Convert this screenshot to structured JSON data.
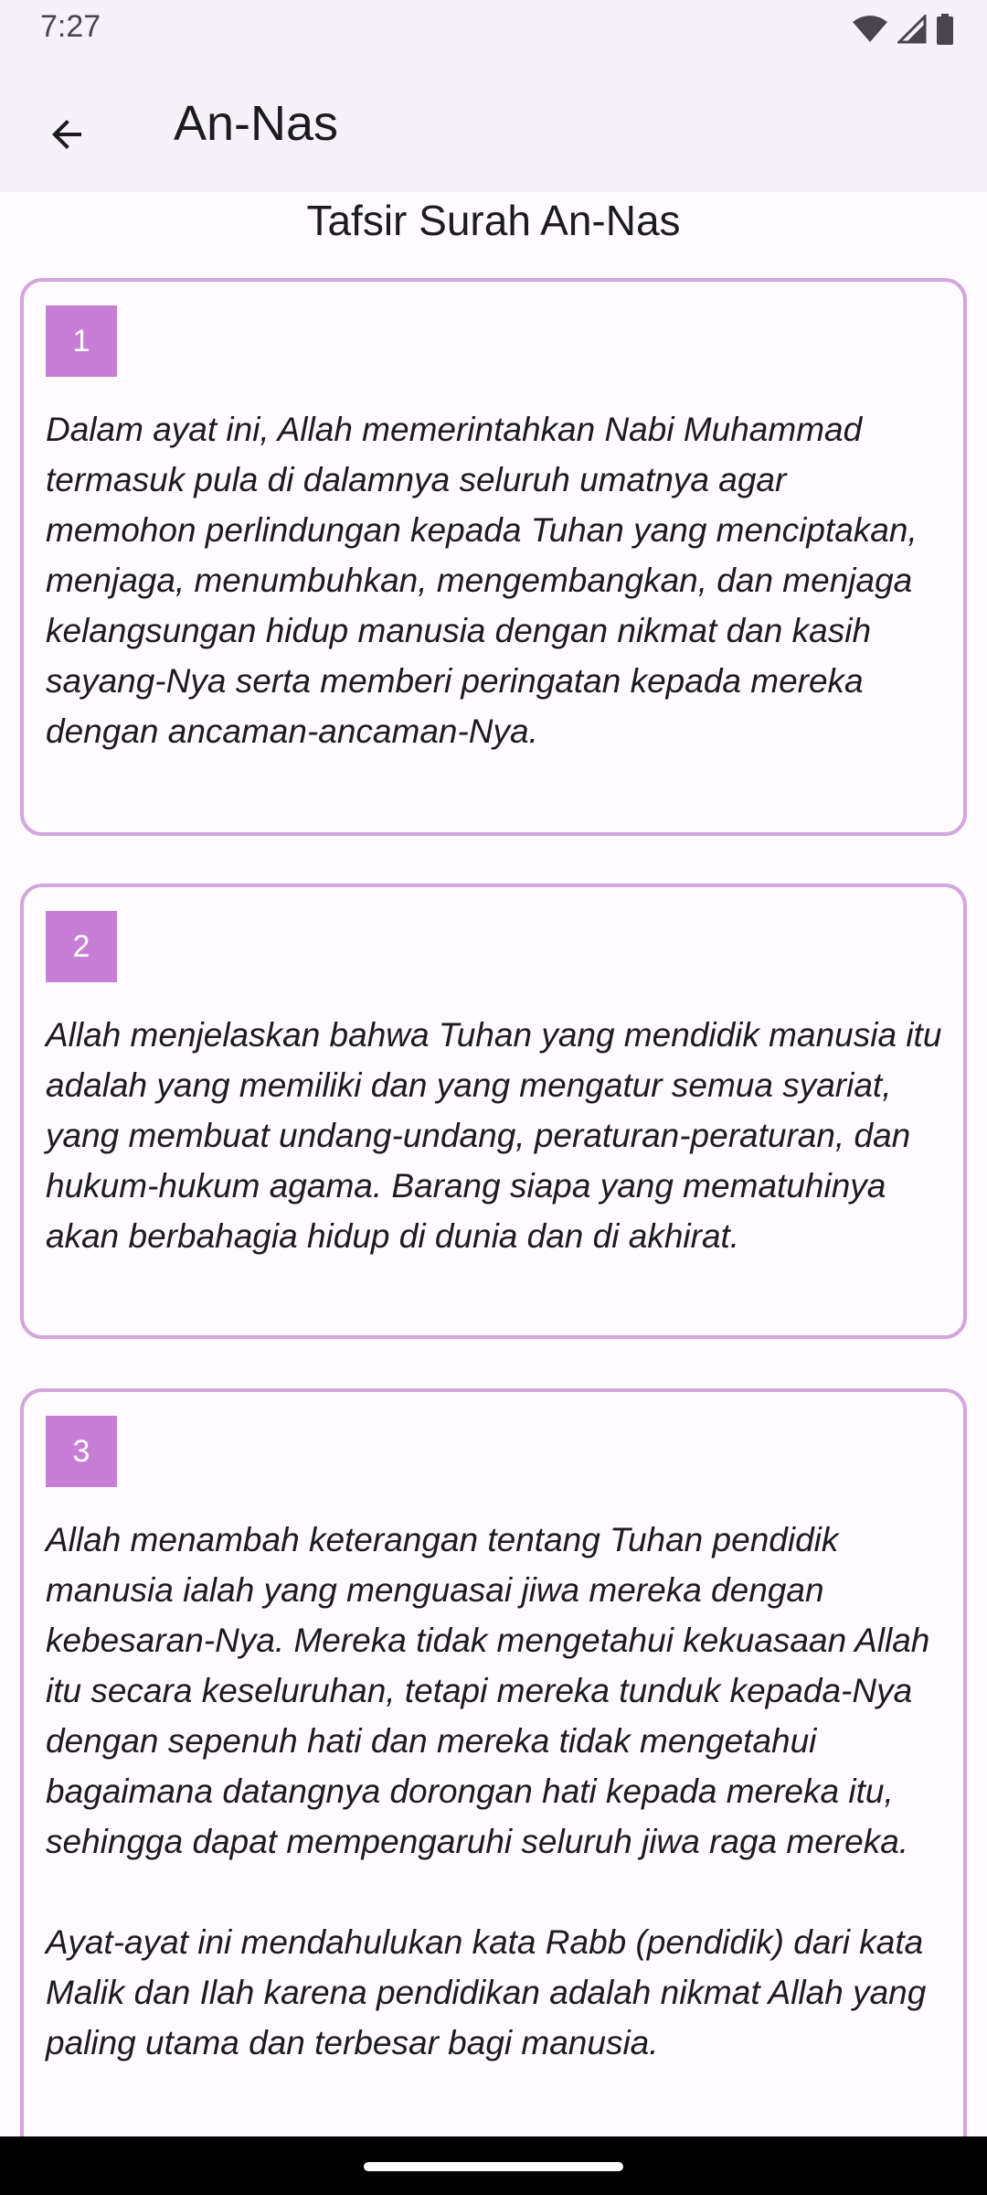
{
  "status_bar": {
    "time": "7:27",
    "icons": [
      "wifi-icon",
      "cellular-signal-icon",
      "battery-icon"
    ]
  },
  "app_bar": {
    "back_icon": "arrow-left-icon",
    "title": "An-Nas"
  },
  "heading": "Tafsir Surah An-Nas",
  "colors": {
    "card_border": "#d3a6de",
    "badge_bg": "#c77fd6",
    "app_bar_bg": "#f7f2fa"
  },
  "tafsir": [
    {
      "number": "1",
      "text": "Dalam ayat ini, Allah memerintahkan Nabi Muhammad termasuk pula di dalamnya seluruh umatnya agar memohon perlindungan kepada Tuhan yang menciptakan, menjaga, menumbuhkan, mengembangkan, dan menjaga kelangsungan hidup manusia dengan nikmat dan kasih sayang-Nya serta memberi peringatan kepada mereka dengan ancaman-ancaman-Nya."
    },
    {
      "number": "2",
      "text": "Allah menjelaskan bahwa Tuhan yang mendidik manusia itu adalah yang memiliki dan yang mengatur semua syariat, yang membuat undang-undang, peraturan-peraturan, dan hukum-hukum agama. Barang siapa yang mematuhinya akan berbahagia hidup di dunia dan di akhirat."
    },
    {
      "number": "3",
      "text": "Allah menambah keterangan tentang Tuhan pendidik manusia ialah yang menguasai jiwa mereka dengan kebesaran-Nya. Mereka tidak mengetahui kekuasaan Allah itu secara keseluruhan, tetapi mereka tunduk kepada-Nya dengan sepenuh hati dan mereka tidak mengetahui bagaimana datangnya dorongan hati kepada mereka itu, sehingga dapat mempengaruhi seluruh jiwa raga mereka.\n\nAyat-ayat ini mendahulukan kata Rabb (pendidik) dari kata Malik dan Ilah karena pendidikan adalah nikmat Allah yang paling utama dan terbesar bagi manusia."
    }
  ]
}
